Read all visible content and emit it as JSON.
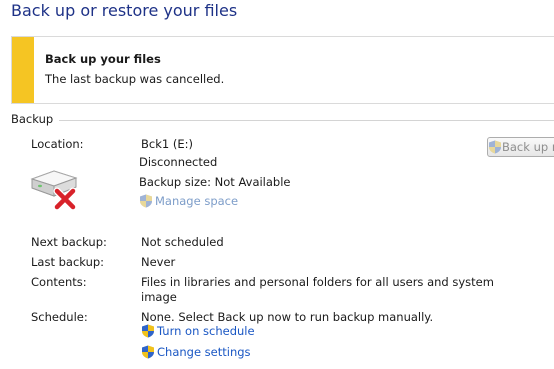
{
  "page": {
    "title": "Back up or restore your files"
  },
  "notice": {
    "title": "Back up your files",
    "message": "The last backup was cancelled.",
    "accent_color": "#f5c523"
  },
  "backup": {
    "section_label": "Backup",
    "location_label": "Location:",
    "location_value": "Bck1 (E:)",
    "status": "Disconnected",
    "size_text": "Backup size: Not Available",
    "manage_space_link": "Manage space",
    "backup_now_button": "Back up now",
    "next_label": "Next backup:",
    "next_value": "Not scheduled",
    "last_label": "Last backup:",
    "last_value": "Never",
    "contents_label": "Contents:",
    "contents_line1": "Files in libraries and personal folders for all users and system",
    "contents_line2": "image",
    "schedule_label": "Schedule:",
    "schedule_value": "None. Select Back up now to run backup manually.",
    "turn_on_link": "Turn on schedule",
    "change_settings_link": "Change settings",
    "drive_icon": "disconnected-drive-icon",
    "shield_icon": "uac-shield-icon"
  }
}
